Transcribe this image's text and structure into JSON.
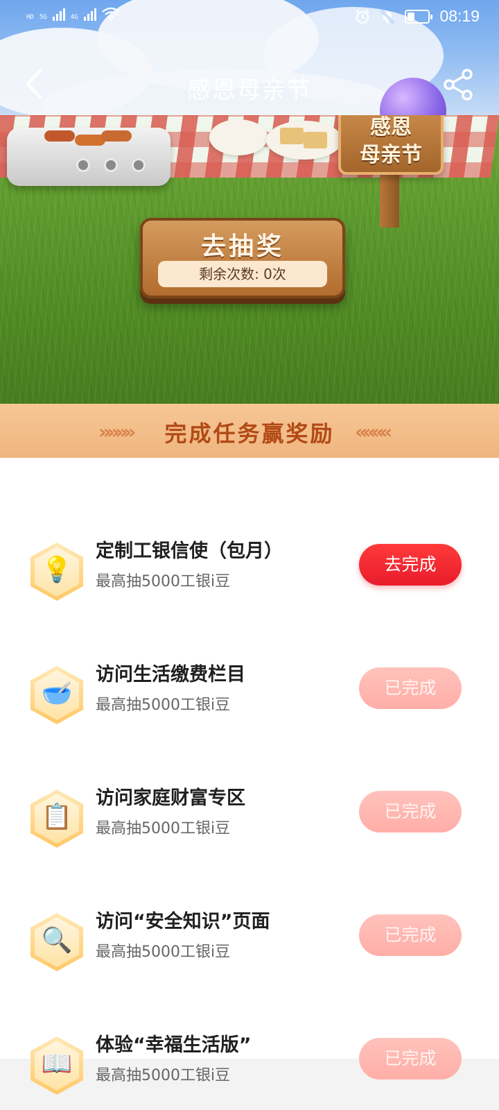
{
  "status_bar": {
    "time": "08:19",
    "network_tiny": "HD",
    "network_5g": "5G",
    "network_4g": "4G",
    "battery_level": 0.35
  },
  "header": {
    "title": "感恩母亲节",
    "back_icon": "chevron-left-icon",
    "share_icon": "share-icon"
  },
  "banner": {
    "sign_line1": "感恩",
    "sign_line2": "母亲节",
    "lottery_button_label": "去抽奖",
    "remaining_label": "剩余次数: 0次"
  },
  "section": {
    "title": "完成任务赢奖励",
    "left_decor": "»»»»",
    "right_decor": "««««"
  },
  "tasks": [
    {
      "icon": "lightbulb-icon",
      "glyph": "💡",
      "title": "定制工银信使（包月）",
      "subtitle": "最高抽5000工银i豆",
      "button": "去完成",
      "state": "active"
    },
    {
      "icon": "payment-icon",
      "glyph": "🥣",
      "title": "访问生活缴费栏目",
      "subtitle": "最高抽5000工银i豆",
      "button": "已完成",
      "state": "done"
    },
    {
      "icon": "clipboard-icon",
      "glyph": "📋",
      "title": "访问家庭财富专区",
      "subtitle": "最高抽5000工银i豆",
      "button": "已完成",
      "state": "done"
    },
    {
      "icon": "magnifier-icon",
      "glyph": "🔍",
      "title": "访问“安全知识”页面",
      "subtitle": "最高抽5000工银i豆",
      "button": "已完成",
      "state": "done"
    },
    {
      "icon": "book-icon",
      "glyph": "📖",
      "title": "体验“幸福生活版”",
      "subtitle": "最高抽5000工银i豆",
      "button": "已完成",
      "state": "done"
    }
  ],
  "colors": {
    "primary_button": "#e81c2c",
    "done_button": "#ffaea7",
    "section_text": "#b24a16"
  }
}
